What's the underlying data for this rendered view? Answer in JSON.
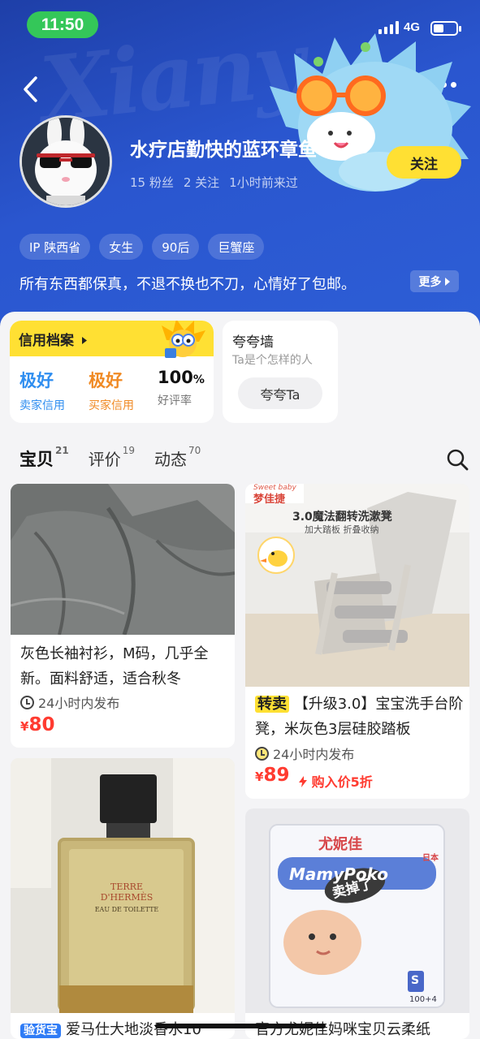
{
  "status_bar": {
    "time": "11:50",
    "network": "4G"
  },
  "header": {
    "watermark": "Xiany",
    "nickname": "水疗店勤快的蓝环章鱼",
    "fans": "15 粉丝",
    "following": "2 关注",
    "last_seen": "1小时前来过",
    "follow_label": "关注",
    "tags": [
      "IP 陕西省",
      "女生",
      "90后",
      "巨蟹座"
    ],
    "bio": "所有东西都保真，不退不换也不刀，心情好了包邮。",
    "more_label": "更多"
  },
  "credit": {
    "title": "信用档案",
    "seller_value": "极好",
    "seller_label": "卖家信用",
    "buyer_value": "极好",
    "buyer_label": "买家信用",
    "rating_value": "100",
    "rating_unit": "%",
    "rating_label": "好评率"
  },
  "praise": {
    "title": "夸夸墙",
    "subtitle": "Ta是个怎样的人",
    "button": "夸夸Ta"
  },
  "tabs": [
    {
      "label": "宝贝",
      "count": "21"
    },
    {
      "label": "评价",
      "count": "19"
    },
    {
      "label": "动态",
      "count": "70"
    }
  ],
  "items": [
    {
      "title": "灰色长袖衬衫，M码，几乎全新。面料舒适，适合秋冬",
      "time": "24小时内发布",
      "currency": "¥",
      "price": "80"
    },
    {
      "badge": "转卖",
      "title": "【升级3.0】宝宝洗手台阶凳，米灰色3层硅胶踏板",
      "time": "24小时内发布",
      "currency": "¥",
      "price": "89",
      "tip": "购入价5折",
      "img_brand": "梦佳捷",
      "img_brand_en": "Sweet baby",
      "img_headline": "3.0魔法翻转洗漱凳",
      "img_subline": "加大踏板 折叠收纳"
    },
    {
      "badge": "验货宝",
      "title": "爱马仕大地淡香水10",
      "img_brand": "TERRE\nD'HERMÈS",
      "img_type": "EAU DE TOILETTE"
    },
    {
      "title": "官方尤妮佳妈咪宝贝云柔纸",
      "img_brand": "尤妮佳",
      "img_logo": "MamyPoko",
      "img_stamp": "卖掉了",
      "img_country": "日本",
      "img_size": "S",
      "img_count": "100+4"
    }
  ],
  "colors": {
    "header_blue": "#2a56cf",
    "accent_yellow": "#ffe033",
    "seller_blue": "#2f8ef0",
    "buyer_orange": "#f08a24",
    "price_red": "#ff3b30"
  }
}
